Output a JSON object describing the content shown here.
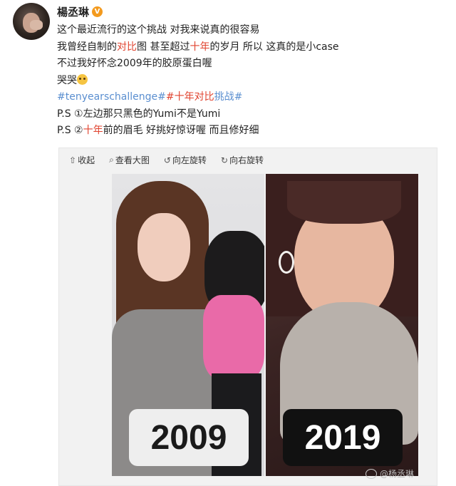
{
  "post": {
    "username": "楊丞琳",
    "verified_icon": "verified-badge-icon",
    "lines": {
      "l1": "这个最近流行的这个挑战 对我来说真的很容易",
      "l2a": "我曾经自制的",
      "l2b": "对比",
      "l2c": "图 甚至超过",
      "l2d": "十年",
      "l2e": "的岁月 所以 这真的是小case",
      "l3": "不过我好怀念2009年的胶原蛋白喔",
      "l4": "哭哭",
      "l5a": "#tenyearschallenge#",
      "l5b": "#十年",
      "l5c": "对比",
      "l5d": "挑战#",
      "l6": "P.S ①左边那只黑色的Yumi不是Yumi",
      "l7a": "P.S ②",
      "l7b": "十年",
      "l7c": "前的眉毛 好挑好惊讶喔 而且修好细"
    },
    "emoji_icon": "crying-emoji-icon"
  },
  "media": {
    "toolbar": {
      "collapse": "收起",
      "view_large": "查看大图",
      "rotate_left": "向左旋转",
      "rotate_right": "向右旋转"
    },
    "photos": {
      "left_year": "2009",
      "right_year": "2019"
    },
    "watermark": "@杨丞琳"
  },
  "colors": {
    "highlight": "#e0432f",
    "hashtag": "#5b8fd0",
    "verified": "#f39a1e"
  }
}
